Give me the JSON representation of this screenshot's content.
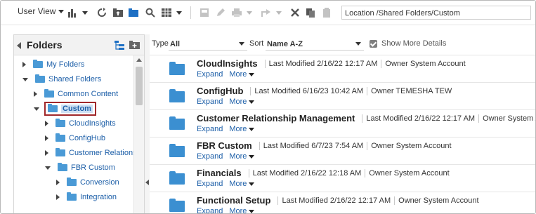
{
  "toolbar": {
    "view_label": "User View",
    "location": "Location /Shared Folders/Custom"
  },
  "left_pane": {
    "title": "Folders",
    "tree": [
      {
        "label": "My Folders",
        "expanded": false,
        "selected": false
      },
      {
        "label": "Shared Folders",
        "expanded": true,
        "selected": false
      },
      {
        "label": "Common Content",
        "expanded": false,
        "selected": false
      },
      {
        "label": "Custom",
        "expanded": true,
        "selected": true
      },
      {
        "label": "CloudInsights",
        "expanded": false,
        "selected": false
      },
      {
        "label": "ConfigHub",
        "expanded": false,
        "selected": false
      },
      {
        "label": "Customer Relationsh",
        "expanded": false,
        "selected": false
      },
      {
        "label": "FBR Custom",
        "expanded": true,
        "selected": false
      },
      {
        "label": "Conversion",
        "expanded": false,
        "selected": false
      },
      {
        "label": "Integration",
        "expanded": false,
        "selected": false
      }
    ]
  },
  "filters": {
    "type_label": "Type",
    "type_value": "All",
    "sort_label": "Sort",
    "sort_value": "Name A-Z",
    "show_more_label": "Show More Details",
    "show_more_checked": true
  },
  "items": [
    {
      "name": "CloudInsights",
      "modified": "Last Modified 2/16/22 12:17 AM",
      "owner": "Owner System Account",
      "expand": "Expand",
      "more": "More"
    },
    {
      "name": "ConfigHub",
      "modified": "Last Modified 6/16/23 10:42 AM",
      "owner": "Owner TEMESHA TEW",
      "expand": "Expand",
      "more": "More"
    },
    {
      "name": "Customer Relationship Management",
      "modified": "Last Modified 2/16/22 12:17 AM",
      "owner": "Owner System Account",
      "expand": "Expand",
      "more": "More"
    },
    {
      "name": "FBR Custom",
      "modified": "Last Modified 6/7/23 7:54 AM",
      "owner": "Owner System Account",
      "expand": "Expand",
      "more": "More"
    },
    {
      "name": "Financials",
      "modified": "Last Modified 2/16/22 12:18 AM",
      "owner": "Owner System Account",
      "expand": "Expand",
      "more": "More"
    },
    {
      "name": "Functional Setup",
      "modified": "Last Modified 2/16/22 12:17 AM",
      "owner": "Owner System Account",
      "expand": "Expand",
      "more": "More"
    }
  ],
  "colors": {
    "accent": "#1d5fa8",
    "folder": "#3b8fd1",
    "selected_highlight": "#cfe0f3",
    "callout": "#a0282b"
  }
}
